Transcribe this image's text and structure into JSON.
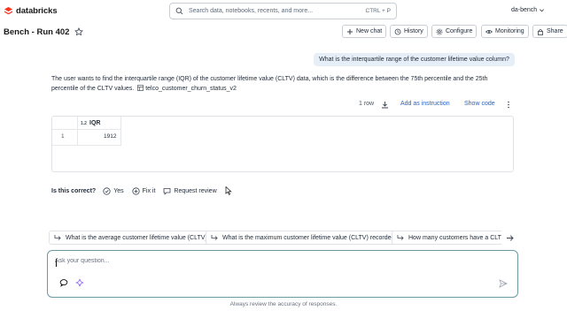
{
  "app": {
    "brand": "databricks"
  },
  "search": {
    "placeholder": "Search data, notebooks, recents, and more...",
    "shortcut": "CTRL + P"
  },
  "user": {
    "workspace": "da-bench"
  },
  "header": {
    "title": "Bench - Run 402",
    "buttons": {
      "new_chat": "New chat",
      "history": "History",
      "configure": "Configure",
      "monitoring": "Monitoring",
      "share": "Share"
    }
  },
  "chat": {
    "question": "What is the interquartile range of the customer lifetime value column?",
    "answer_line1": "The user wants to find the interquartile range (IQR) of the customer lifetime value (CLTV) data, which is the difference between the 75th percentile and the 25th",
    "answer_line2": "percentile of the CLTV values.",
    "table_ref": "telco_customer_churn_status_v2",
    "result": {
      "row_count": "1 row",
      "add_instruction": "Add as instruction",
      "show_code": "Show code",
      "columns": [
        "IQR"
      ],
      "rows": [
        {
          "index": "1",
          "IQR": "1912"
        }
      ]
    },
    "feedback": {
      "question": "Is this correct?",
      "yes": "Yes",
      "fix": "Fix it",
      "review": "Request review"
    }
  },
  "suggestions": [
    "What is the average customer lifetime value (CLTV)?",
    "What is the maximum customer lifetime value (CLTV) recorded?",
    "How many customers have a CLTV g"
  ],
  "composer": {
    "placeholder": "Ask your question..."
  },
  "footer": {
    "disclaimer": "Always review the accuracy of responses."
  },
  "colors": {
    "accent_link": "#2563c7",
    "bubble": "#e6eef7",
    "composer_border": "#6b9aa0",
    "brand": "#ff3621"
  }
}
